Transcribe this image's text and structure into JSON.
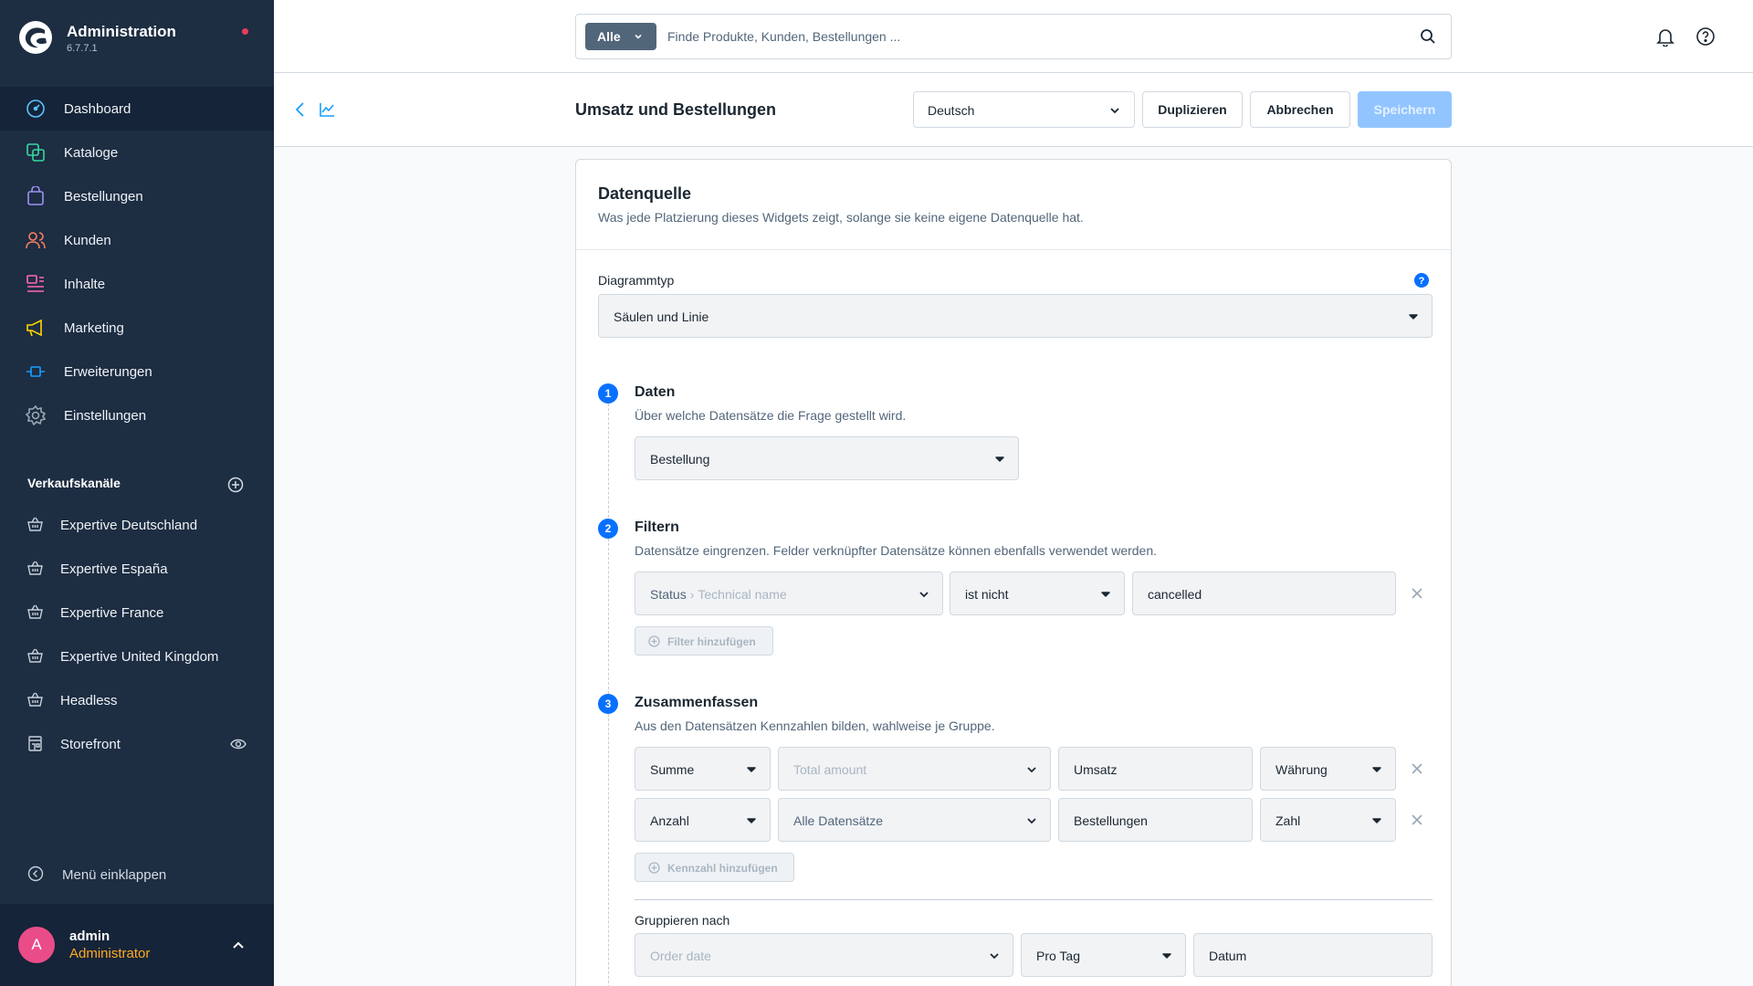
{
  "brand": {
    "title": "Administration",
    "version": "6.7.7.1"
  },
  "nav": [
    {
      "label": "Dashboard",
      "icon": "dashboard-icon"
    },
    {
      "label": "Kataloge",
      "icon": "catalog-icon"
    },
    {
      "label": "Bestellungen",
      "icon": "orders-icon"
    },
    {
      "label": "Kunden",
      "icon": "customers-icon"
    },
    {
      "label": "Inhalte",
      "icon": "content-icon"
    },
    {
      "label": "Marketing",
      "icon": "marketing-icon"
    },
    {
      "label": "Erweiterungen",
      "icon": "extensions-icon"
    },
    {
      "label": "Einstellungen",
      "icon": "settings-icon"
    }
  ],
  "sales_channels": {
    "title": "Verkaufskanäle",
    "items": [
      {
        "label": "Expertive Deutschland"
      },
      {
        "label": "Expertive España"
      },
      {
        "label": "Expertive France"
      },
      {
        "label": "Expertive United Kingdom"
      },
      {
        "label": "Headless"
      },
      {
        "label": "Storefront"
      }
    ]
  },
  "collapse_label": "Menü einklappen",
  "user": {
    "initial": "A",
    "name": "admin",
    "role": "Administrator"
  },
  "search": {
    "type_label": "Alle",
    "placeholder": "Finde Produkte, Kunden, Bestellungen ..."
  },
  "page": {
    "title": "Umsatz und Bestellungen",
    "language": "Deutsch",
    "duplicate_label": "Duplizieren",
    "cancel_label": "Abbrechen",
    "save_label": "Speichern"
  },
  "card": {
    "title": "Datenquelle",
    "subtitle": "Was jede Platzierung dieses Widgets zeigt, solange sie keine eigene Datenquelle hat.",
    "chart_type_label": "Diagrammtyp",
    "chart_type_value": "Säulen und Linie"
  },
  "steps": {
    "data": {
      "num": "1",
      "title": "Daten",
      "desc": "Über welche Datensätze die Frage gestellt wird.",
      "entity": "Bestellung"
    },
    "filter": {
      "num": "2",
      "title": "Filtern",
      "desc": "Datensätze eingrenzen. Felder verknüpfter Datensätze können ebenfalls verwendet werden.",
      "field": "Status",
      "field_sub": "Technical name",
      "operator": "ist nicht",
      "value": "cancelled",
      "add_label": "Filter hinzufügen"
    },
    "aggregate": {
      "num": "3",
      "title": "Zusammenfassen",
      "desc": "Aus den Datensätzen Kennzahlen bilden, wahlweise je Gruppe.",
      "rows": [
        {
          "func": "Summe",
          "field": "Total amount",
          "name": "Umsatz",
          "format": "Währung"
        },
        {
          "func": "Anzahl",
          "field": "Alle Datensätze",
          "name": "Bestellungen",
          "format": "Zahl"
        }
      ],
      "add_label": "Kennzahl hinzufügen",
      "group_label": "Gruppieren nach",
      "group_field": "Order date",
      "group_interval": "Pro Tag",
      "group_name": "Datum"
    }
  }
}
